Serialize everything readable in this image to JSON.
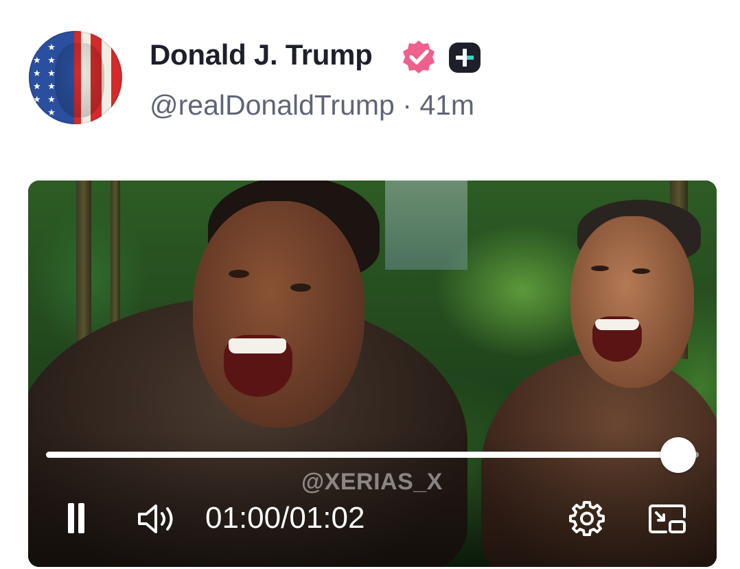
{
  "post": {
    "display_name": "Donald J. Trump",
    "handle": "@realDonaldTrump",
    "separator": "·",
    "time_ago": "41m",
    "avatar_icon": "flag-portrait-avatar",
    "verified_icon": "verified-badge-icon",
    "verified_color": "#f0608c",
    "plus_icon": "plus-badge-icon"
  },
  "video": {
    "watermark": "@XERIAS_X",
    "current_time": "01:00",
    "duration": "01:02",
    "time_separator": "/",
    "progress": 0.968,
    "state": "playing",
    "controls": {
      "pause_icon": "pause-icon",
      "volume_icon": "volume-icon",
      "settings_icon": "settings-icon",
      "pip_icon": "picture-in-picture-icon"
    }
  }
}
